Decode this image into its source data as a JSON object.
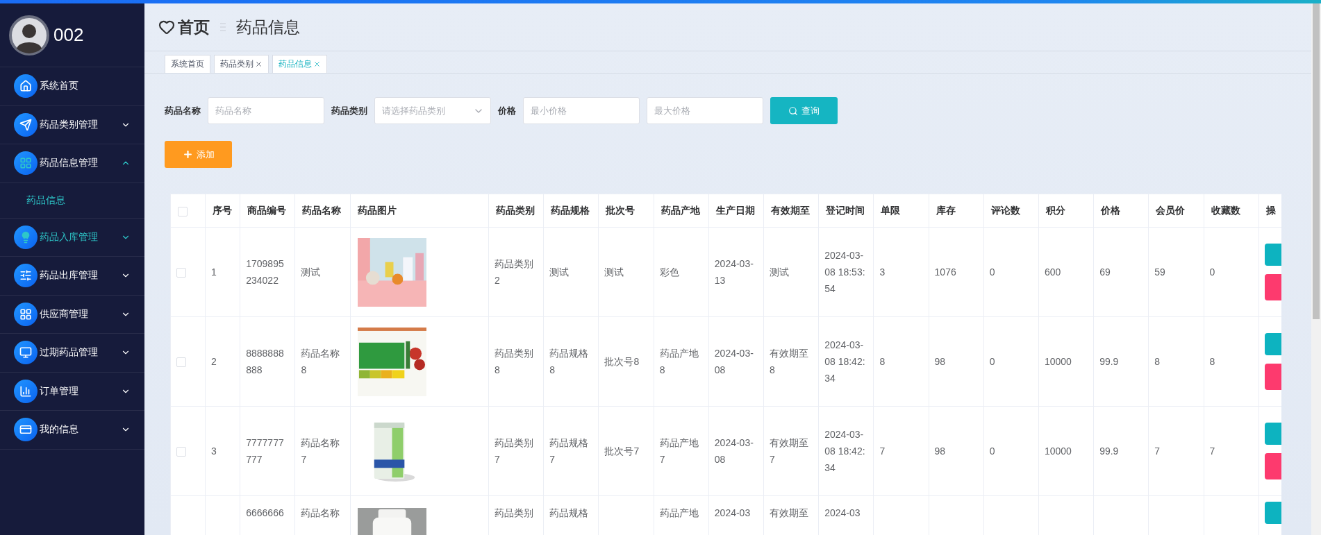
{
  "user": {
    "name": "002"
  },
  "sidebar": {
    "items": [
      {
        "label": "系统首页",
        "kind": "link",
        "highlighted": false
      },
      {
        "label": "药品类别管理",
        "kind": "menu",
        "expanded": false,
        "highlighted": false
      },
      {
        "label": "药品信息管理",
        "kind": "menu",
        "expanded": true,
        "highlighted": false,
        "children": [
          {
            "label": "药品信息",
            "selected": true
          }
        ]
      },
      {
        "label": "药品入库管理",
        "kind": "menu",
        "expanded": false,
        "highlighted": true
      },
      {
        "label": "药品出库管理",
        "kind": "menu",
        "expanded": false,
        "highlighted": false
      },
      {
        "label": "供应商管理",
        "kind": "menu",
        "expanded": false,
        "highlighted": false
      },
      {
        "label": "过期药品管理",
        "kind": "menu",
        "expanded": false,
        "highlighted": false
      },
      {
        "label": "订单管理",
        "kind": "menu",
        "expanded": false,
        "highlighted": false
      },
      {
        "label": "我的信息",
        "kind": "menu",
        "expanded": false,
        "highlighted": false
      }
    ]
  },
  "breadcrumb": {
    "home": "首页",
    "current": "药品信息"
  },
  "tabs": [
    {
      "label": "系统首页",
      "closable": false,
      "selected": false
    },
    {
      "label": "药品类别",
      "closable": true,
      "selected": false
    },
    {
      "label": "药品信息",
      "closable": true,
      "selected": true
    }
  ],
  "search": {
    "fields": [
      {
        "label": "药品名称",
        "kind": "input",
        "placeholder": "药品名称"
      },
      {
        "label": "药品类别",
        "kind": "select",
        "placeholder": "请选择药品类别"
      },
      {
        "label": "价格",
        "kind": "input",
        "placeholder": "最小价格"
      },
      {
        "kind": "input",
        "placeholder": "最大价格"
      }
    ],
    "button": "查询"
  },
  "add_button": "添加",
  "table": {
    "select_all": {
      "checked": false
    },
    "columns": [
      {
        "kind": "checkbox"
      },
      {
        "kind": "text",
        "label": "序号"
      },
      {
        "kind": "text",
        "label": "商品编号"
      },
      {
        "kind": "text",
        "label": "药品名称"
      },
      {
        "label": "药品图片"
      },
      {
        "kind": "text",
        "label": "药品类别"
      },
      {
        "kind": "text",
        "label": "药品规格"
      },
      {
        "kind": "text",
        "label": "批次号"
      },
      {
        "kind": "text",
        "label": "药品产地"
      },
      {
        "kind": "text",
        "label": "生产日期"
      },
      {
        "kind": "text",
        "label": "有效期至"
      },
      {
        "kind": "text",
        "label": "登记时间"
      },
      {
        "kind": "text",
        "label": "单限"
      },
      {
        "kind": "text",
        "label": "库存"
      },
      {
        "kind": "text",
        "label": "评论数"
      },
      {
        "kind": "text",
        "label": "积分"
      },
      {
        "kind": "text",
        "label": "价格"
      },
      {
        "kind": "text",
        "label": "会员价"
      },
      {
        "kind": "text",
        "label": "收藏数"
      },
      {
        "kind": "actions",
        "label": "操"
      }
    ],
    "rows": [
      {
        "checked": false,
        "cells": {
          "no": "1",
          "code": "1709895234022",
          "name": "测试",
          "category": "药品类别2",
          "spec": "测试",
          "batch": "测试",
          "origin": "彩色",
          "produced": "2024-03-13",
          "expiry": "测试",
          "registered": "2024-03-08 18:53:54",
          "limit": "3",
          "stock": "1076",
          "reviews": "0",
          "points": "600",
          "price": "69",
          "member_price": "59",
          "favorites": "0"
        },
        "image": {
          "kind": "picture"
        },
        "actions": [
          {
            "kind": "edit"
          },
          {
            "kind": "delete"
          }
        ]
      },
      {
        "checked": false,
        "cells": {
          "no": "2",
          "code": "8888888888",
          "name": "药品名称8",
          "category": "药品类别8",
          "spec": "药品规格8",
          "batch": "批次号8",
          "origin": "药品产地8",
          "produced": "2024-03-08",
          "expiry": "有效期至8",
          "registered": "2024-03-08 18:42:34",
          "limit": "8",
          "stock": "98",
          "reviews": "0",
          "points": "10000",
          "price": "99.9",
          "member_price": "8",
          "favorites": "8"
        },
        "image": {
          "kind": "picture"
        },
        "actions": [
          {
            "kind": "edit"
          },
          {
            "kind": "delete"
          }
        ]
      },
      {
        "checked": false,
        "cells": {
          "no": "3",
          "code": "7777777777",
          "name": "药品名称7",
          "category": "药品类别7",
          "spec": "药品规格7",
          "batch": "批次号7",
          "origin": "药品产地7",
          "produced": "2024-03-08",
          "expiry": "有效期至7",
          "registered": "2024-03-08 18:42:34",
          "limit": "7",
          "stock": "98",
          "reviews": "0",
          "points": "10000",
          "price": "99.9",
          "member_price": "7",
          "favorites": "7"
        },
        "image": {
          "kind": "picture"
        },
        "actions": [
          {
            "kind": "edit"
          },
          {
            "kind": "delete"
          }
        ]
      },
      {
        "cells": {
          "code": "6666666",
          "name": "药品名称",
          "category": "药品类别",
          "spec": "药品规格",
          "origin": "药品产地",
          "produced": "2024-03",
          "expiry": "有效期至",
          "registered": "2024-03"
        },
        "image": {
          "kind": "picture"
        },
        "actions": [
          {
            "kind": "edit"
          }
        ]
      }
    ]
  }
}
